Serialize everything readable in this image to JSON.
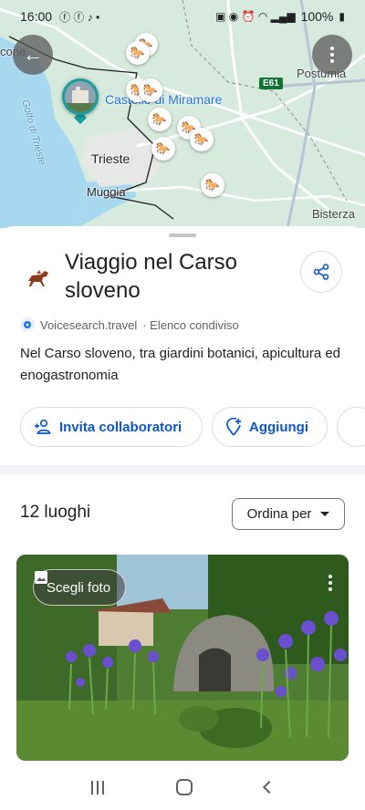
{
  "status_bar": {
    "time": "16:00",
    "battery": "100%"
  },
  "map": {
    "labels": {
      "top_left": "cone",
      "gulf": "Golfo di Trieste",
      "castle": "Castello di Miramare",
      "trieste": "Trieste",
      "muggia": "Muggia",
      "postumia": "Postumia",
      "bisterza": "Bisterza",
      "road": "E61"
    }
  },
  "list": {
    "title": "Viaggio nel Carso sloveno",
    "source": "Voicesearch.travel",
    "shared": "· Elenco condiviso",
    "description": "Nel Carso sloveno, tra giardini botanici, apicultura ed enogastronomia",
    "invite_label": "Invita collaboratori",
    "add_label": "Aggiungi",
    "places_count": "12 luoghi",
    "sort_label": "Ordina per",
    "choose_photo_label": "Scegli foto"
  },
  "colors": {
    "accent": "#0b57d0",
    "map_green": "#d6eadd",
    "sea": "#a8d8f0"
  }
}
